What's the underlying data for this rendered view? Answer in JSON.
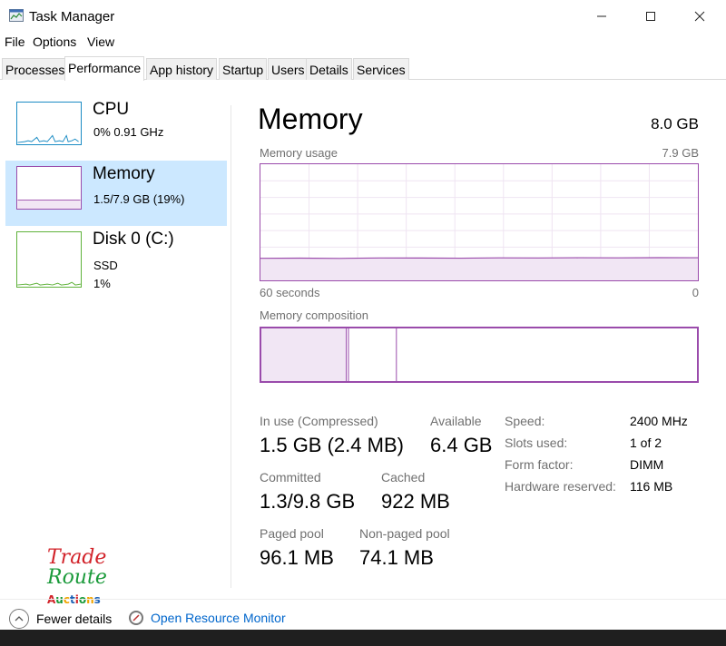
{
  "window": {
    "title": "Task Manager",
    "minimize": "—",
    "maximize": "☐",
    "close": "✕"
  },
  "menu": [
    {
      "label": "File"
    },
    {
      "label": "Options"
    },
    {
      "label": "View"
    }
  ],
  "tabs": [
    {
      "label": "Processes",
      "active": false
    },
    {
      "label": "Performance",
      "active": true
    },
    {
      "label": "App history",
      "active": false
    },
    {
      "label": "Startup",
      "active": false
    },
    {
      "label": "Users",
      "active": false
    },
    {
      "label": "Details",
      "active": false
    },
    {
      "label": "Services",
      "active": false
    }
  ],
  "sidebar": {
    "items": [
      {
        "name": "CPU",
        "line1": "0%  0.91 GHz",
        "line2": "",
        "color": "#1b8cc4",
        "selected": false
      },
      {
        "name": "Memory",
        "line1": "1.5/7.9 GB (19%)",
        "line2": "",
        "color": "#9a4bab",
        "selected": true
      },
      {
        "name": "Disk 0 (C:)",
        "line1": "SSD",
        "line2": "1%",
        "color": "#5fb23a",
        "selected": false
      }
    ]
  },
  "main": {
    "title": "Memory",
    "total": "8.0 GB",
    "usage_label": "Memory usage",
    "usage_max": "7.9 GB",
    "axis_left": "60 seconds",
    "axis_right": "0",
    "composition_label": "Memory composition",
    "usage_fraction": 0.19,
    "accent": "#9a4bab",
    "composition": {
      "in_use_fraction": 0.195,
      "modified_fraction": 0.005,
      "standby_fraction": 0.11
    },
    "stats": {
      "in_use": {
        "label": "In use (Compressed)",
        "value": "1.5 GB (2.4 MB)"
      },
      "available": {
        "label": "Available",
        "value": "6.4 GB"
      },
      "committed": {
        "label": "Committed",
        "value": "1.3/9.8 GB"
      },
      "cached": {
        "label": "Cached",
        "value": "922 MB"
      },
      "paged_pool": {
        "label": "Paged pool",
        "value": "96.1 MB"
      },
      "non_paged_pool": {
        "label": "Non-paged pool",
        "value": "74.1 MB"
      }
    },
    "details": [
      {
        "label": "Speed:",
        "value": "2400 MHz"
      },
      {
        "label": "Slots used:",
        "value": "1 of 2"
      },
      {
        "label": "Form factor:",
        "value": "DIMM"
      },
      {
        "label": "Hardware reserved:",
        "value": "116 MB"
      }
    ]
  },
  "footer": {
    "fewer_details": "Fewer details",
    "open_monitor": "Open Resource Monitor"
  },
  "logo": {
    "line1": "Trade",
    "line2": "Route",
    "line3": "Auctions"
  }
}
